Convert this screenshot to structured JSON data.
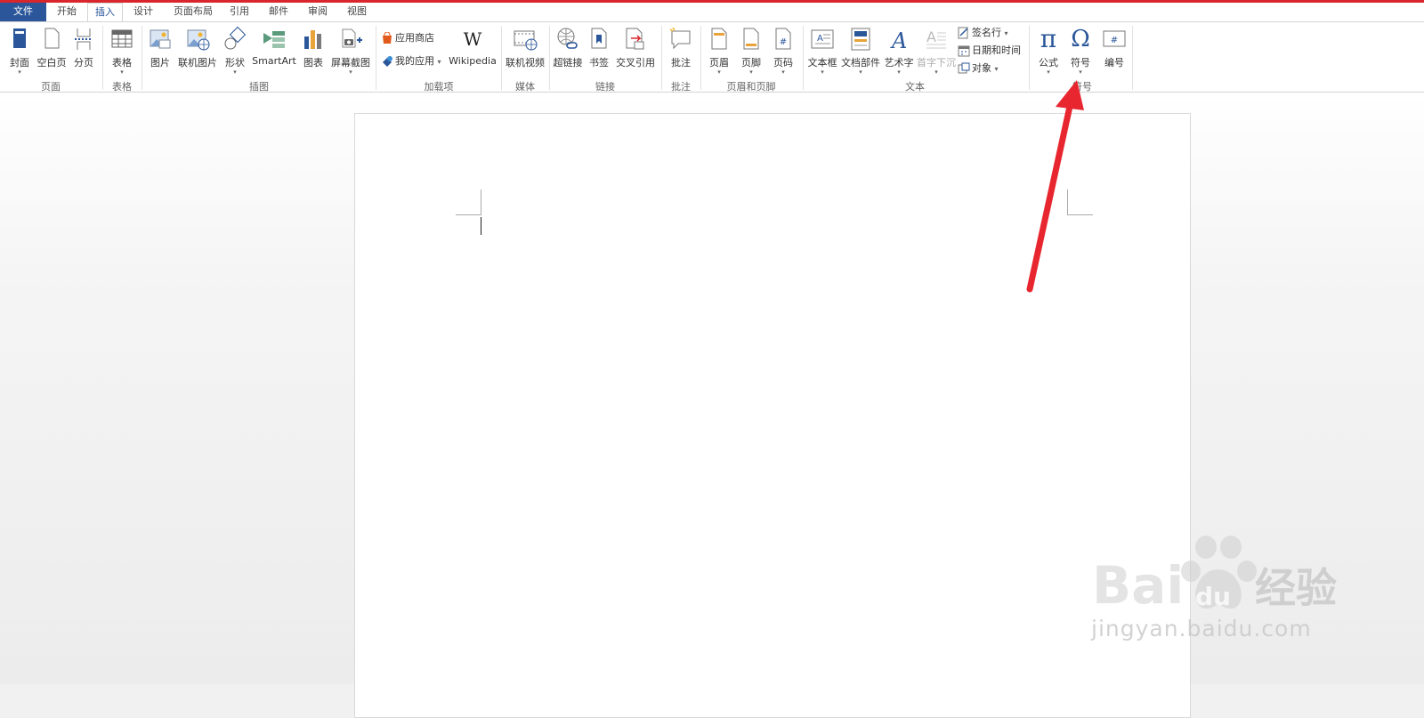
{
  "tabs": [
    "文件",
    "开始",
    "插入",
    "设计",
    "页面布局",
    "引用",
    "邮件",
    "审阅",
    "视图"
  ],
  "ribbon": {
    "page": {
      "label": "页面",
      "buttons": [
        "封面",
        "空白页",
        "分页"
      ]
    },
    "table": {
      "label": "表格",
      "buttons": [
        "表格"
      ]
    },
    "illustrations": {
      "label": "插图",
      "buttons": [
        "图片",
        "联机图片",
        "形状",
        "SmartArt",
        "图表",
        "屏幕截图"
      ]
    },
    "addins": {
      "label": "加载项",
      "store": "应用商店",
      "myapps": "我的应用",
      "wikipedia": "Wikipedia",
      "wiki_glyph": "W"
    },
    "media": {
      "label": "媒体",
      "buttons": [
        "联机视频"
      ]
    },
    "links": {
      "label": "链接",
      "buttons": [
        "超链接",
        "书签",
        "交叉引用"
      ]
    },
    "comments": {
      "label": "批注",
      "buttons": [
        "批注"
      ]
    },
    "headerfooter": {
      "label": "页眉和页脚",
      "buttons": [
        "页眉",
        "页脚",
        "页码"
      ]
    },
    "text": {
      "label": "文本",
      "buttons": [
        "文本框",
        "文档部件",
        "艺术字",
        "首字下沉"
      ],
      "signature": "签名行",
      "datetime": "日期和时间",
      "object": "对象"
    },
    "symbols": {
      "label": "符号",
      "buttons": [
        "公式",
        "符号",
        "编号"
      ],
      "pi": "π",
      "omega": "Ω"
    }
  },
  "watermark": {
    "brand": "Bai",
    "brand2": "du",
    "cn": "经验",
    "url": "jingyan.baidu.com"
  },
  "colors": {
    "file_tab": "#2b579a",
    "accent_top": "#d9262c",
    "arrow": "#e8262f",
    "icon_blue": "#2b579a"
  }
}
